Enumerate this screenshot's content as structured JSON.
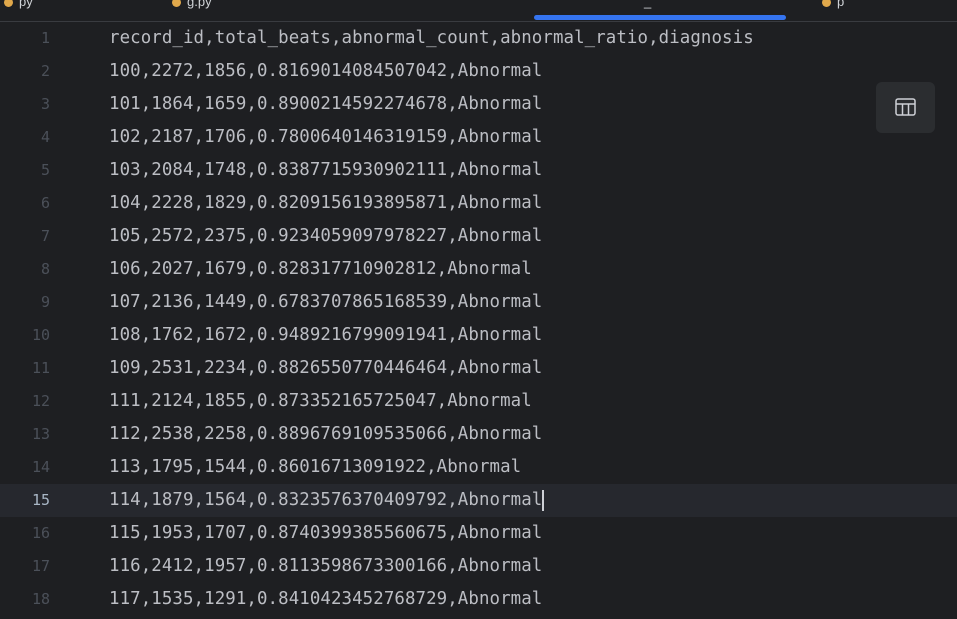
{
  "tabs": [
    {
      "label": "py"
    },
    {
      "label": "g.py"
    },
    {
      "label": "_"
    },
    {
      "label": "p"
    }
  ],
  "toolbar": {
    "table_view_icon": "table-icon"
  },
  "editor": {
    "current_line": 15,
    "lines": [
      {
        "num": "1",
        "text": "record_id,total_beats,abnormal_count,abnormal_ratio,diagnosis"
      },
      {
        "num": "2",
        "text": "100,2272,1856,0.8169014084507042,Abnormal"
      },
      {
        "num": "3",
        "text": "101,1864,1659,0.8900214592274678,Abnormal"
      },
      {
        "num": "4",
        "text": "102,2187,1706,0.7800640146319159,Abnormal"
      },
      {
        "num": "5",
        "text": "103,2084,1748,0.8387715930902111,Abnormal"
      },
      {
        "num": "6",
        "text": "104,2228,1829,0.8209156193895871,Abnormal"
      },
      {
        "num": "7",
        "text": "105,2572,2375,0.9234059097978227,Abnormal"
      },
      {
        "num": "8",
        "text": "106,2027,1679,0.82831771090281 2,Abnormal"
      },
      {
        "num": "9",
        "text": "107,2136,1449,0.6783707865168539,Abnormal"
      },
      {
        "num": "10",
        "text": "108,1762,1672,0.9489216799091941,Abnormal"
      },
      {
        "num": "11",
        "text": "109,2531,2234,0.8826550770446464,Abnormal"
      },
      {
        "num": "12",
        "text": "111,2124,1855,0.873352165725047,Abnormal"
      },
      {
        "num": "13",
        "text": "112,2538,2258,0.8896769109535066,Abnormal"
      },
      {
        "num": "14",
        "text": "113,1795,1544,0.86016713091922,Abnormal"
      },
      {
        "num": "15",
        "text": "114,1879,1564,0.8323576370409792,Abnormal"
      },
      {
        "num": "16",
        "text": "115,1953,1707,0.8740399385560675,Abnormal"
      },
      {
        "num": "17",
        "text": "116,2412,1957,0.8113598673300166,Abnormal"
      },
      {
        "num": "18",
        "text": "117,1535,1291,0.8410423452768729,Abnormal"
      }
    ]
  },
  "colors": {
    "background": "#1e1f22",
    "current_line": "#26282e",
    "text": "#bcbec4",
    "line_number": "#4b5059",
    "tab_underline": "#3574f0"
  }
}
